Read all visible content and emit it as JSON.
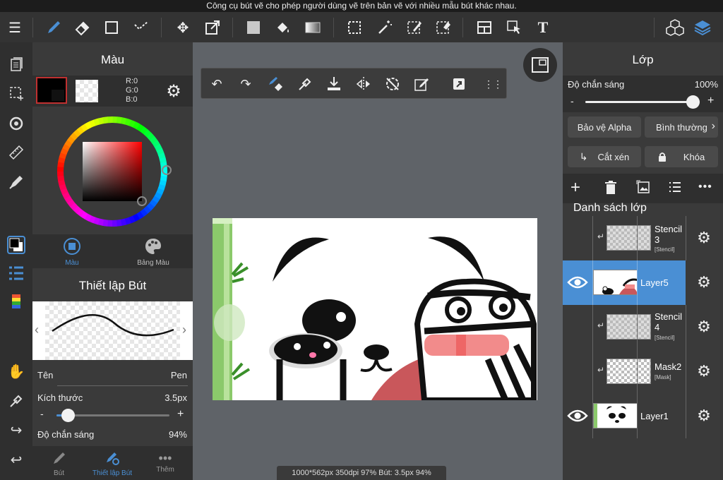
{
  "caption": "Công cụ bút vẽ cho phép người dùng vẽ trên bản vẽ với nhiều mẫu bút khác nhau.",
  "color_panel": {
    "title": "Màu",
    "rgb": {
      "r": "R:0",
      "g": "G:0",
      "b": "B:0"
    },
    "tabs": [
      {
        "label": "Màu"
      },
      {
        "label": "Bảng Màu"
      }
    ]
  },
  "brush_panel": {
    "title": "Thiết lập Bút",
    "name_label": "Tên",
    "name_value": "Pen",
    "size_label": "Kích thước",
    "size_value": "3.5px",
    "size_fraction": 0.1,
    "opacity_label": "Độ chắn sáng",
    "opacity_value": "94%",
    "bottom_tabs": [
      {
        "label": "Bút"
      },
      {
        "label": "Thiết lập Bút"
      },
      {
        "label": "Thêm"
      }
    ]
  },
  "layer_panel": {
    "title": "Lớp",
    "opacity_label": "Độ chắn sáng",
    "opacity_value": "100%",
    "opacity_fraction": 1.0,
    "alpha_protect": "Bảo vệ Alpha",
    "blend_mode": "Bình thường",
    "clipping": "Cắt xén",
    "lock": "Khóa",
    "list_title": "Danh sách lớp",
    "layers": [
      {
        "name": "Stencil 3",
        "name_line1": "Stencil",
        "name_line2": "3",
        "sub": "[Stencil]"
      },
      {
        "name": "Layer5",
        "sub": ""
      },
      {
        "name": "Stencil 4",
        "name_line1": "Stencil",
        "name_line2": "4",
        "sub": "[Stencil]"
      },
      {
        "name": "Mask2",
        "sub": "[Mask]"
      },
      {
        "name": "Layer1",
        "sub": ""
      }
    ]
  },
  "status": "1000*562px 350dpi 97% Bút: 3.5px 94%",
  "colors": {
    "accent": "#4a8fd4",
    "selected_layer": "#4a8fd4",
    "current_color": "#000000"
  }
}
